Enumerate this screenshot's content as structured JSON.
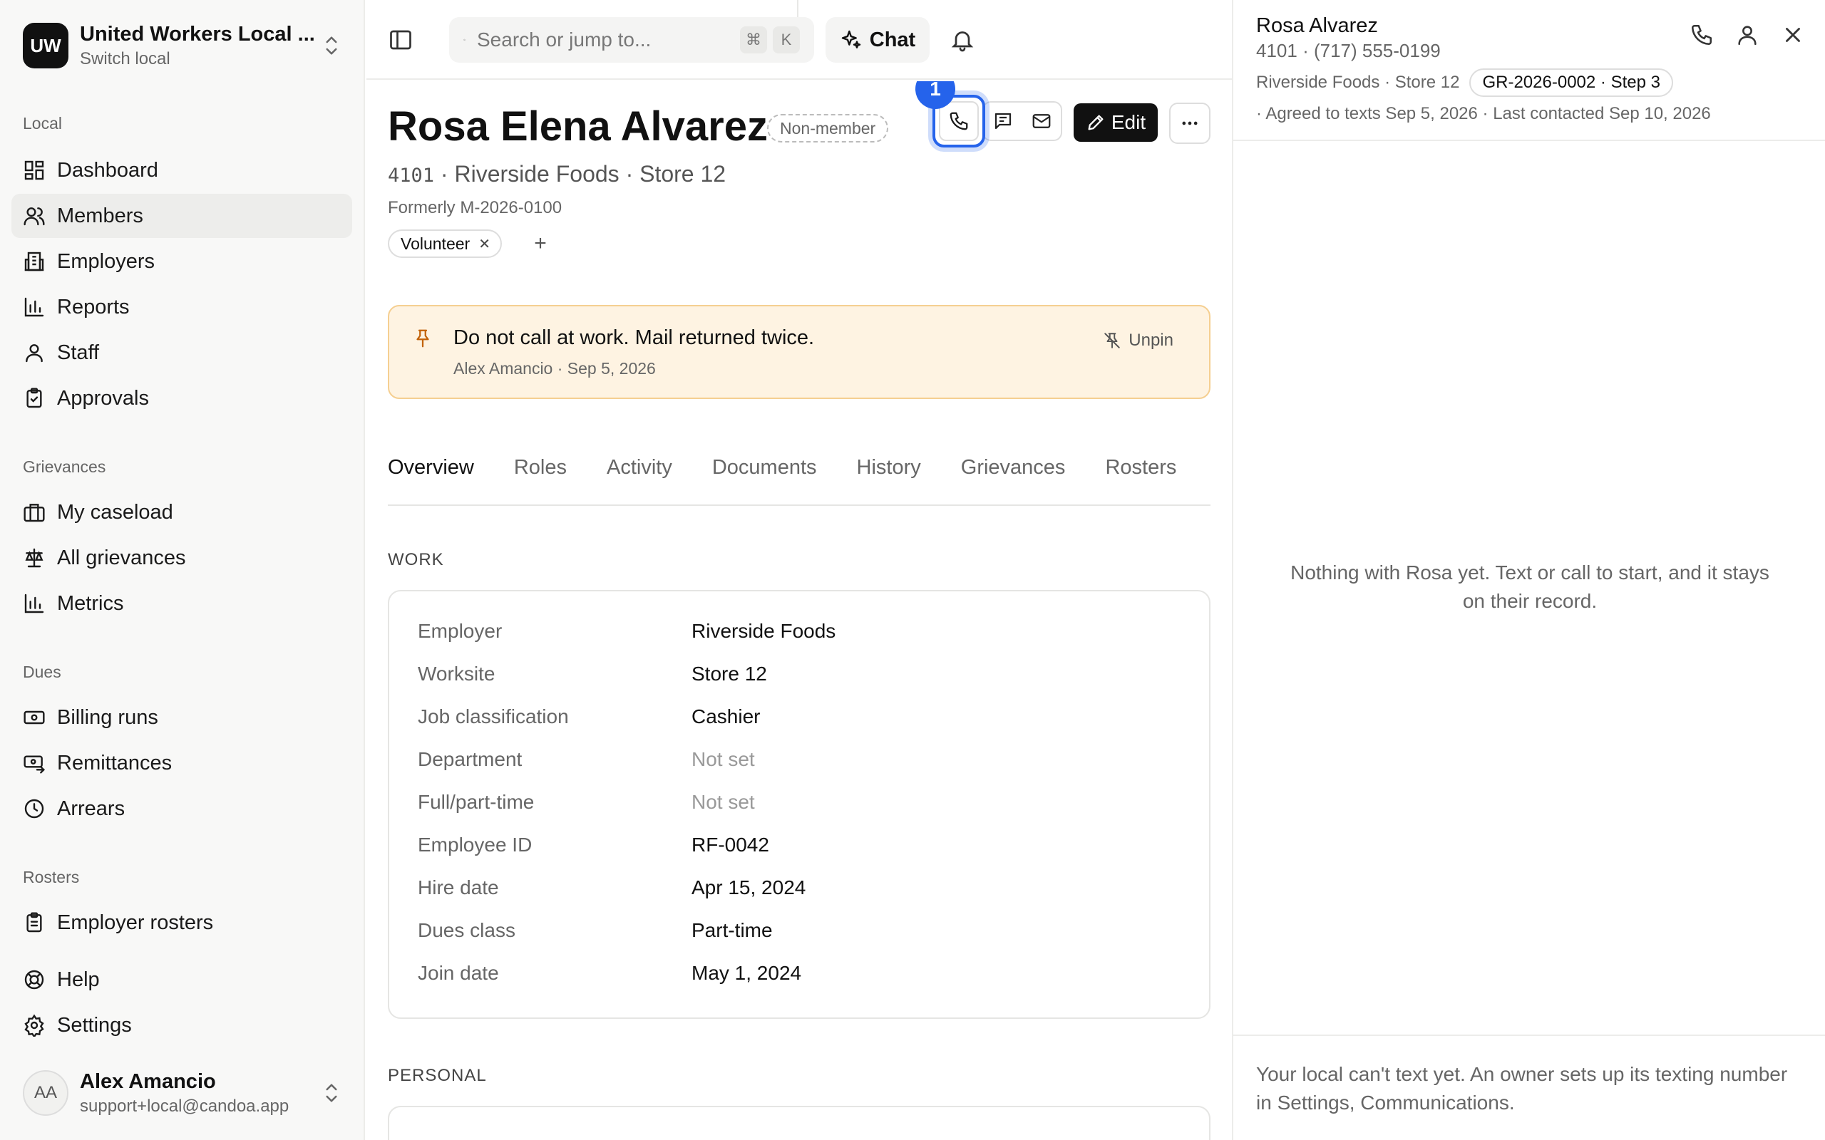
{
  "org": {
    "initials": "UW",
    "name": "United Workers Local ...",
    "subtitle": "Switch local"
  },
  "sidebar": {
    "sections": {
      "local": "Local",
      "grievances": "Grievances",
      "dues": "Dues",
      "rosters": "Rosters"
    },
    "local_items": [
      "Dashboard",
      "Members",
      "Employers",
      "Reports",
      "Staff",
      "Approvals"
    ],
    "grievance_items": [
      "My caseload",
      "All grievances",
      "Metrics"
    ],
    "dues_items": [
      "Billing runs",
      "Remittances",
      "Arrears"
    ],
    "roster_items": [
      "Employer rosters"
    ],
    "bottom_items": [
      "Help",
      "Settings"
    ],
    "active_item": "Members"
  },
  "user": {
    "initials": "AA",
    "name": "Alex Amancio",
    "email": "support+local@candoa.app"
  },
  "topbar": {
    "search_placeholder": "Search or jump to...",
    "shortcut_keys": [
      "⌘",
      "K"
    ],
    "chat_label": "Chat"
  },
  "member": {
    "name": "Rosa Elena Alvarez",
    "status_badge": "Non-member",
    "number": "4101",
    "employer_line": " · Riverside Foods · Store 12",
    "formerly": "Formerly M-2026-0100",
    "tags": [
      "Volunteer"
    ],
    "add_tag": "+",
    "step_number": "1",
    "edit_label": "Edit"
  },
  "note": {
    "text": "Do not call at work. Mail returned twice.",
    "meta": "Alex Amancio · Sep 5, 2026",
    "unpin_label": "Unpin"
  },
  "tabs": [
    "Overview",
    "Roles",
    "Activity",
    "Documents",
    "History",
    "Grievances",
    "Rosters"
  ],
  "active_tab": "Overview",
  "work": {
    "heading": "WORK",
    "rows": [
      {
        "label": "Employer",
        "value": "Riverside Foods"
      },
      {
        "label": "Worksite",
        "value": "Store 12"
      },
      {
        "label": "Job classification",
        "value": "Cashier"
      },
      {
        "label": "Department",
        "value": "Not set"
      },
      {
        "label": "Full/part-time",
        "value": "Not set"
      },
      {
        "label": "Employee ID",
        "value": "RF-0042"
      },
      {
        "label": "Hire date",
        "value": "Apr 15, 2024"
      },
      {
        "label": "Dues class",
        "value": "Part-time"
      },
      {
        "label": "Join date",
        "value": "May 1, 2024"
      }
    ]
  },
  "personal": {
    "heading": "PERSONAL"
  },
  "panel": {
    "name": "Rosa Alvarez",
    "phone_line": "4101 · (717) 555-0199",
    "worksite": "Riverside Foods · Store 12",
    "grievance_badge": "GR-2026-0002 · Step 3",
    "consent_line": "· Agreed to texts Sep 5, 2026  · Last contacted Sep 10, 2026",
    "empty_state": "Nothing with Rosa yet. Text or call to start, and it stays on their record.",
    "footer": "Your local can't text yet. An owner sets up its texting number in Settings, Communications."
  }
}
